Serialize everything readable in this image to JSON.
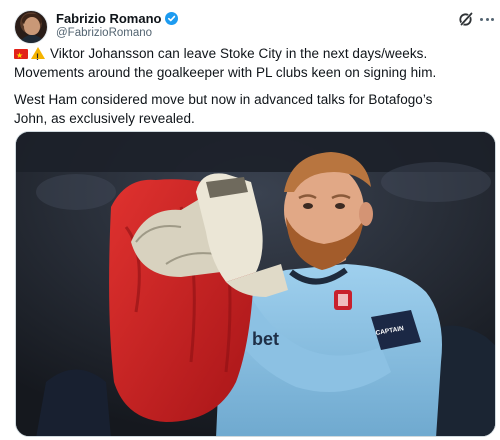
{
  "author": {
    "display_name": "Fabrizio Romano",
    "handle": "@FabrizioRomano",
    "verified": true,
    "badge_color": "#1d9bf0"
  },
  "tweet": {
    "paragraph1_line1": "Viktor Johansson can leave Stoke City in the next days/weeks.",
    "paragraph1_line2": "Movements around the goalkeeper with PL clubs keen on signing him.",
    "paragraph2_line1": "West Ham considered move but now in advanced talks for Botafogo’s",
    "paragraph2_line2": "John, as exclusively revealed.",
    "emoji": [
      "flag-icon",
      "warning-icon"
    ]
  },
  "media": {
    "shirt_text": "bet",
    "armband_text": "CAPTAIN"
  },
  "icons": {
    "top_right": [
      "grok-icon",
      "more-icon"
    ]
  }
}
